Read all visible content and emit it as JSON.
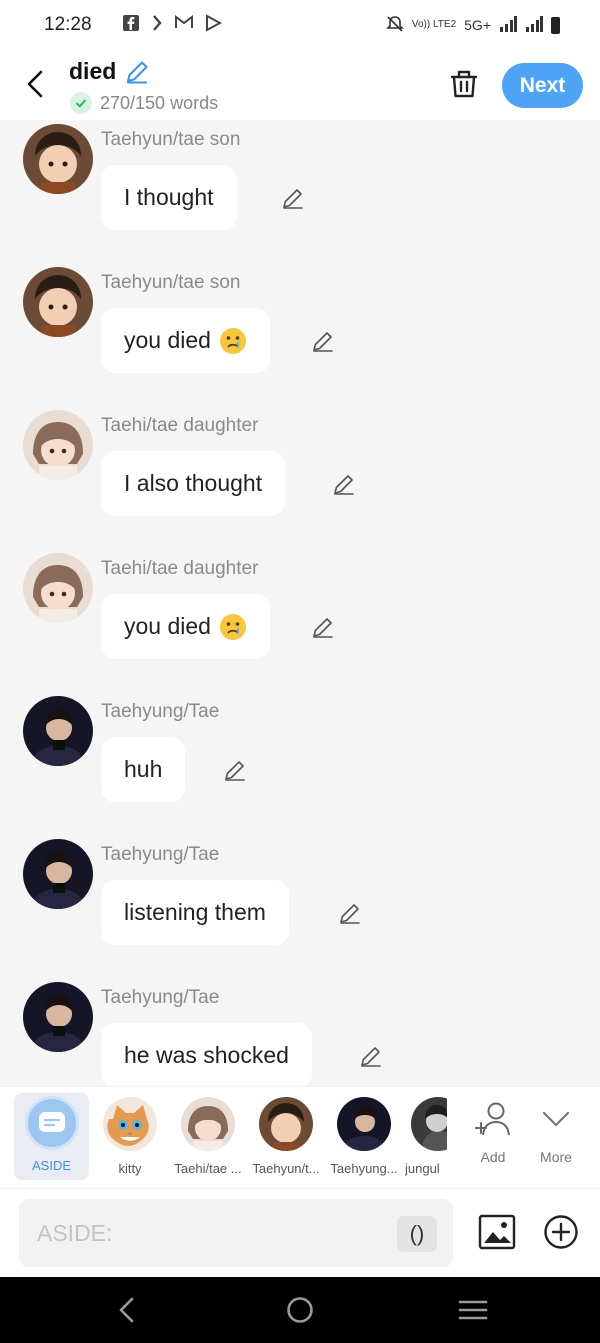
{
  "status_bar": {
    "time": "12:28",
    "network_small": "Vo)) LTE2",
    "network": "5G+"
  },
  "header": {
    "title": "died",
    "word_count": "270/150 words",
    "next_label": "Next"
  },
  "messages": [
    {
      "sender": "Taehyun/tae son",
      "text": "I thought",
      "emoji": ""
    },
    {
      "sender": "Taehyun/tae son",
      "text": "you died",
      "emoji": "crying-face"
    },
    {
      "sender": "Taehi/tae daughter",
      "text": "I also thought",
      "emoji": ""
    },
    {
      "sender": "Taehi/tae daughter",
      "text": "you died",
      "emoji": "crying-face"
    },
    {
      "sender": "Taehyung/Tae",
      "text": "huh",
      "emoji": ""
    },
    {
      "sender": "Taehyung/Tae",
      "text": "listening them",
      "emoji": ""
    },
    {
      "sender": "Taehyung/Tae",
      "text": "he was shocked",
      "emoji": ""
    }
  ],
  "character_bar": {
    "aside_label": "ASIDE",
    "characters": [
      {
        "label": "kitty"
      },
      {
        "label": "Taehi/tae ..."
      },
      {
        "label": "Taehyun/t..."
      },
      {
        "label": "Taehyung..."
      },
      {
        "label": "jungul"
      }
    ],
    "add_label": "Add",
    "more_label": "More"
  },
  "input_bar": {
    "placeholder": "ASIDE:",
    "paren_label": "()"
  },
  "colors": {
    "accent": "#4ea3f5",
    "aside": "#3f91e8",
    "background": "#f5f5f5"
  }
}
